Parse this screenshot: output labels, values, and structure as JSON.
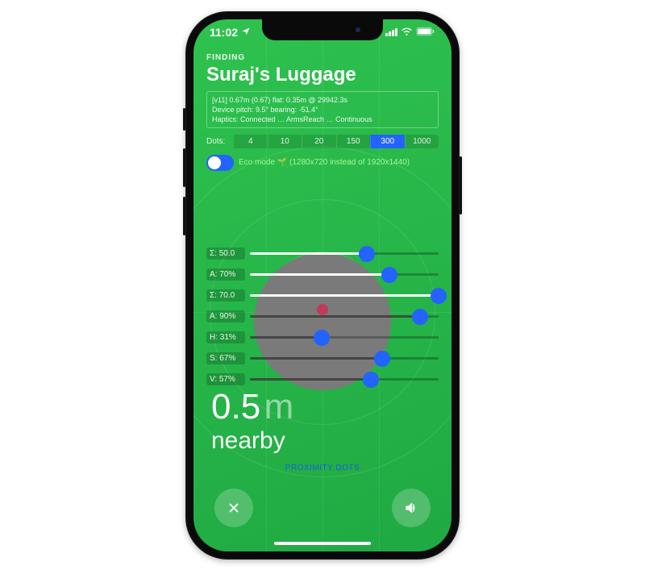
{
  "status": {
    "time": "11:02",
    "location_icon": "◤",
    "signal": 4,
    "wifi": "on",
    "battery": "full"
  },
  "header": {
    "finding_label": "FINDING",
    "device_name": "Suraj's Luggage"
  },
  "debug": {
    "line1": "[v11] 0.67m (0.67) flat: 0.35m @ 29942.3s",
    "line2": "Device pitch: 9.5° bearing: -51.4°",
    "line3": "Haptics: Connected … ArmsReach … Continuous"
  },
  "segments": {
    "label": "Dots:",
    "options": [
      "4",
      "10",
      "20",
      "150",
      "300",
      "1000"
    ],
    "selected": "300"
  },
  "eco": {
    "label": "Eco mode 🌱  (1280x720 instead of 1920x1440)",
    "on": true
  },
  "sliders": [
    {
      "label": "Σ: 50.0",
      "pct": 62,
      "style": "white"
    },
    {
      "label": "A: 70%",
      "pct": 74,
      "style": "white"
    },
    {
      "label": "Σ: 70.0",
      "pct": 100,
      "style": "white"
    },
    {
      "label": "A: 90%",
      "pct": 90,
      "style": "dark"
    },
    {
      "label": "H: 31%",
      "pct": 38,
      "style": "dark"
    },
    {
      "label": "S: 67%",
      "pct": 70,
      "style": "dark"
    },
    {
      "label": "V: 57%",
      "pct": 64,
      "style": "dark"
    }
  ],
  "distance": {
    "value": "0.5",
    "unit": "m",
    "label": "nearby"
  },
  "proximity_label": "PROXIMITY DOTS",
  "buttons": {
    "close": "✕",
    "sound": "🔊"
  }
}
